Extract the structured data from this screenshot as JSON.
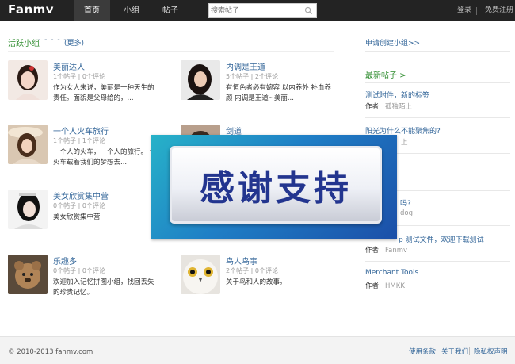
{
  "header": {
    "logo": "Fanmv",
    "nav": [
      "首页",
      "小组",
      "帖子"
    ],
    "search_placeholder": "搜索帖子",
    "login": "登录",
    "register": "免费注册"
  },
  "groups_section": {
    "title": "活跃小组",
    "dots": "- - - - - -",
    "more": "(更多)",
    "groups": [
      {
        "name": "美丽达人",
        "stats": "1个帖子 | 0个评论",
        "desc": "作为女人来说，美丽是一种天生的责任。面貌是父母给的，..."
      },
      {
        "name": "内调是王道",
        "stats": "5个帖子 | 2个评论",
        "desc": "有恒色者必有婉容 以内养外 补血养颜 内调是王道~美丽..."
      },
      {
        "name": "一个人火车旅行",
        "stats": "1个帖子 | 1个评论",
        "desc": "一个人的火车，一个人的旅行。 让火车载着我们的梦想去..."
      },
      {
        "name": "剑道",
        "stats": "",
        "desc": ""
      },
      {
        "name": "美女欣赏集中营",
        "stats": "0个帖子 | 0个评论",
        "desc": "美女欣赏集中营"
      },
      {
        "name": "",
        "stats": "",
        "desc": ""
      },
      {
        "name": "乐趣多",
        "stats": "0个帖子 | 0个评论",
        "desc": "欢迎加入记忆拼图小组，找回丢失的珍贵记忆。"
      },
      {
        "name": "鸟人鸟事",
        "stats": "2个帖子 | 0个评论",
        "desc": "关于鸟和人的故事。"
      }
    ]
  },
  "sidebar": {
    "apply": "申请创建小组>>",
    "latest_title": "最新帖子 >",
    "posts": [
      {
        "title": "测试附件，新的标签",
        "label": "作者",
        "author": "孤独陌上"
      },
      {
        "title": "阳光为什么不能聚焦的?",
        "label": "",
        "author": "上"
      },
      {
        "title": "吗?",
        "label": "",
        "author": "dog"
      },
      {
        "title": "p 测试文件，欢迎下载测试",
        "label": "作者",
        "author": "Fanmv"
      },
      {
        "title": "Merchant Tools",
        "label": "作者",
        "author": "HMKK"
      }
    ]
  },
  "footer": {
    "copyright": "© 2010-2013 fanmv.com",
    "links": [
      "使用条款",
      "关于我们",
      "隐私权声明"
    ]
  },
  "overlay": {
    "text": "感谢支持"
  }
}
